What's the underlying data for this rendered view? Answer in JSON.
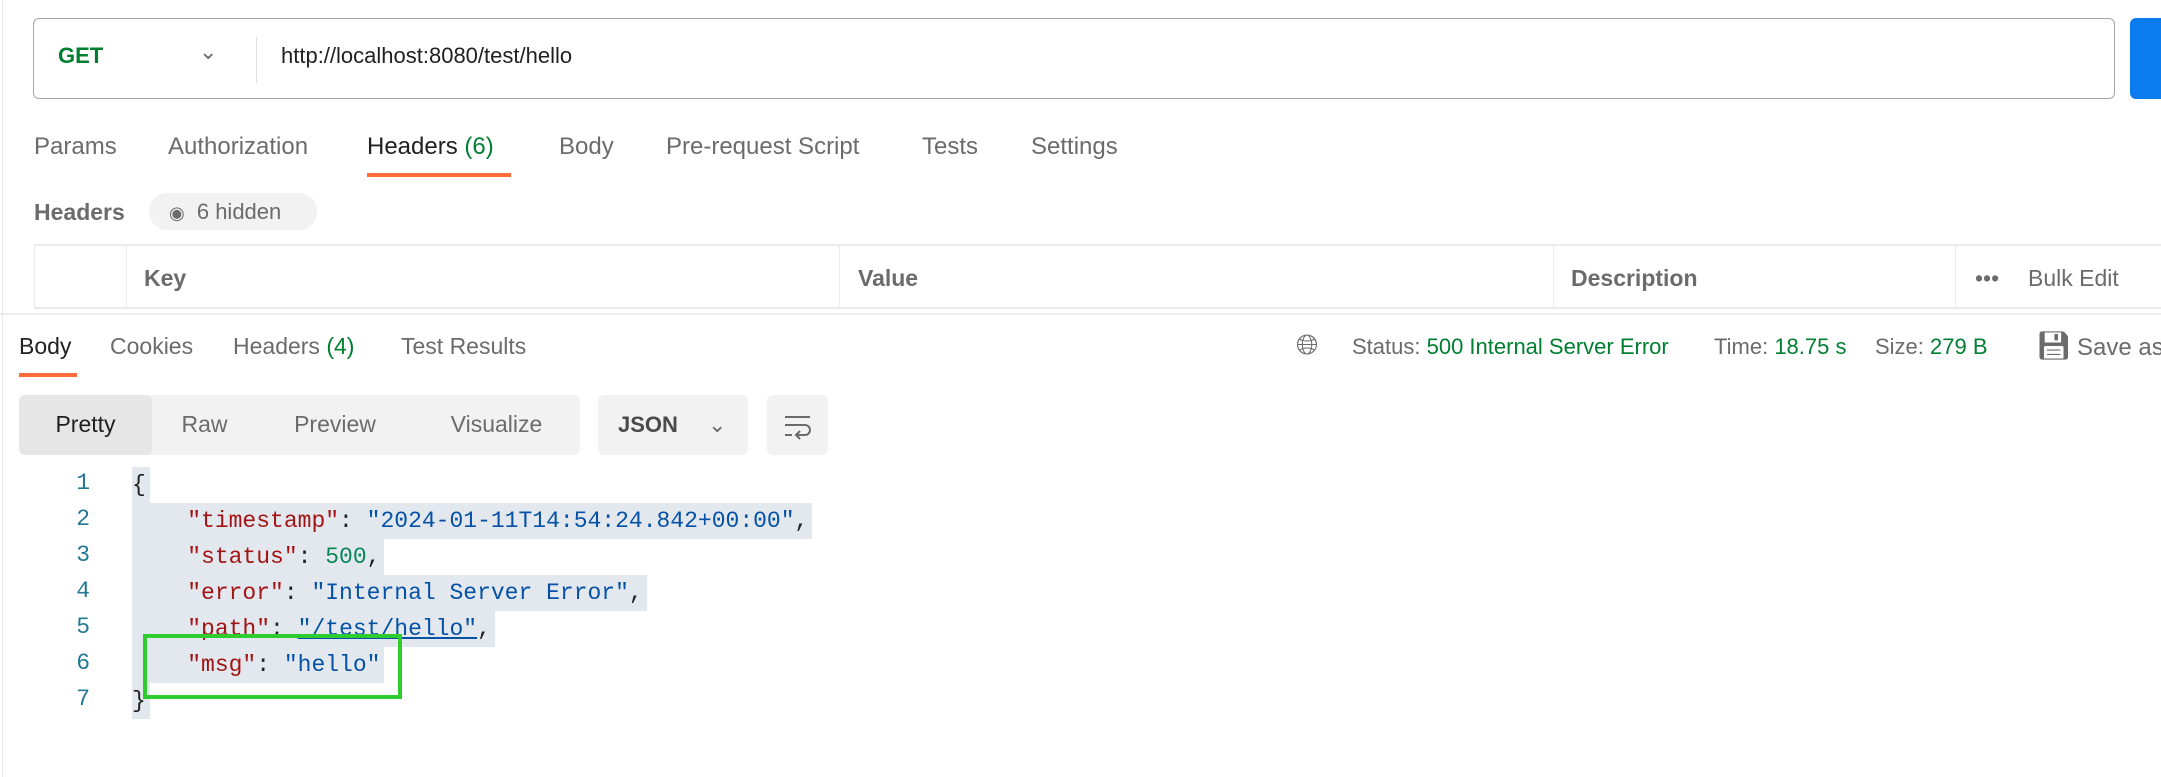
{
  "request": {
    "method": "GET",
    "url": "http://localhost:8080/test/hello"
  },
  "request_tabs": [
    {
      "label": "Params"
    },
    {
      "label": "Authorization"
    },
    {
      "label": "Headers",
      "count": "(6)"
    },
    {
      "label": "Body"
    },
    {
      "label": "Pre-request Script"
    },
    {
      "label": "Tests"
    },
    {
      "label": "Settings"
    }
  ],
  "headers_section": {
    "title": "Headers",
    "hidden": "6 hidden",
    "columns": [
      "Key",
      "Value",
      "Description"
    ],
    "bulk_edit": "Bulk Edit"
  },
  "response_tabs": [
    {
      "label": "Body"
    },
    {
      "label": "Cookies"
    },
    {
      "label": "Headers",
      "count": "(4)"
    },
    {
      "label": "Test Results"
    }
  ],
  "response_meta": {
    "status_label": "Status:",
    "status": "500 Internal Server Error",
    "time_label": "Time:",
    "time": "18.75 s",
    "size_label": "Size:",
    "size": "279 B",
    "save": "Save as"
  },
  "view_modes": [
    "Pretty",
    "Raw",
    "Preview",
    "Visualize"
  ],
  "format": "JSON",
  "body": {
    "line_numbers": [
      "1",
      "2",
      "3",
      "4",
      "5",
      "6",
      "7"
    ],
    "open": "{",
    "close": "}",
    "fields": [
      {
        "key": "\"timestamp\"",
        "value": "\"2024-01-11T14:54:24.842+00:00\""
      },
      {
        "key": "\"status\"",
        "value": "500"
      },
      {
        "key": "\"error\"",
        "value": "\"Internal Server Error\""
      },
      {
        "key": "\"path\"",
        "value": "\"/test/hello\""
      },
      {
        "key": "\"msg\"",
        "value": "\"hello\""
      }
    ]
  },
  "colors": {
    "accent": "#ff6c37",
    "success": "#007f31",
    "send": "#0a7cf0",
    "highlight_box": "#2ecc2e"
  }
}
